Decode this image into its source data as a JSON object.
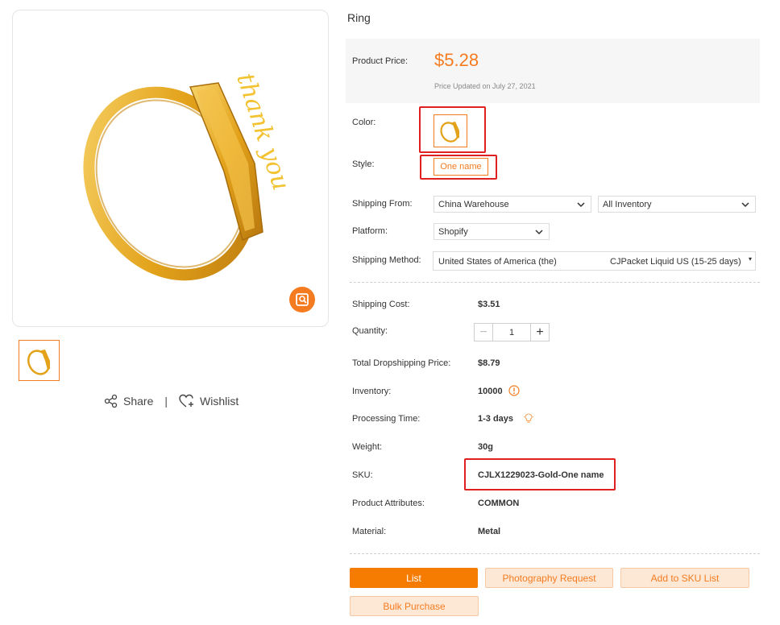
{
  "gallery": {
    "main_image_alt": "thank you",
    "zoom_icon": "image-zoom-icon",
    "share_label": "Share",
    "separator": "|",
    "wishlist_label": "Wishlist"
  },
  "product": {
    "title": "Ring",
    "price_label": "Product Price:",
    "price": "$5.28",
    "price_updated": "Price Updated on July 27, 2021"
  },
  "variants": {
    "color_label": "Color:",
    "style_label": "Style:",
    "style_option": "One name"
  },
  "shipping": {
    "from_label": "Shipping From:",
    "from_value": "China Warehouse",
    "inventory_filter": "All Inventory",
    "platform_label": "Platform:",
    "platform_value": "Shopify",
    "method_label": "Shipping Method:",
    "method_country": "United States of America (the)",
    "method_carrier": "CJPacket Liquid US (15-25 days)",
    "method_indicator": "▾"
  },
  "details": {
    "shipping_cost_label": "Shipping Cost:",
    "shipping_cost": "$3.51",
    "quantity_label": "Quantity:",
    "quantity": "1",
    "qty_minus": "−",
    "qty_plus": "+",
    "total_label": "Total Dropshipping Price:",
    "total": "$8.79",
    "inventory_label": "Inventory:",
    "inventory": "10000",
    "processing_label": "Processing Time:",
    "processing": "1-3 days",
    "weight_label": "Weight:",
    "weight": "30g",
    "sku_label": "SKU:",
    "sku": "CJLX1229023-Gold-One name",
    "attributes_label": "Product Attributes:",
    "attributes": "COMMON",
    "material_label": "Material:",
    "material": "Metal"
  },
  "actions": {
    "list": "List",
    "photography": "Photography Request",
    "add_sku": "Add to SKU List",
    "bulk": "Bulk Purchase"
  },
  "colors": {
    "accent": "#f47b20",
    "highlight_box": "#e02020",
    "gold": "#e8a317"
  }
}
